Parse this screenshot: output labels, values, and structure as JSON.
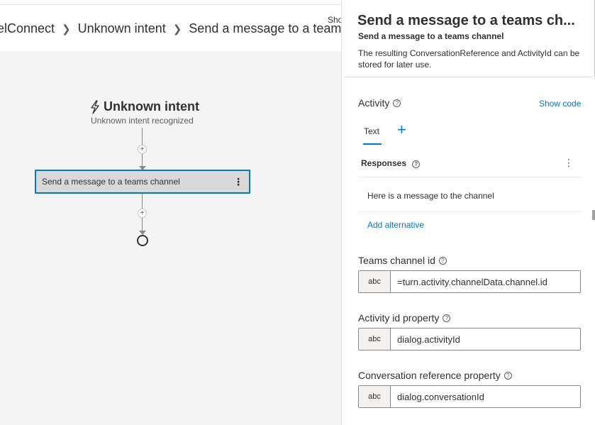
{
  "breadcrumb": {
    "items": [
      "elConnect",
      "Unknown intent",
      "Send a message to a teams channel"
    ],
    "cut_text": "Show code"
  },
  "canvas": {
    "trigger_title": "Unknown intent",
    "trigger_subtitle": "Unknown intent recognized",
    "node_label": "Send a message to a teams channel",
    "node_more": "⋮",
    "plus_glyph": "+"
  },
  "panel": {
    "title": "Send a message to a teams ch...",
    "subtitle": "Send a message to a teams channel",
    "description": "The resulting ConversationReference and ActivityId can be stored for later use.",
    "activity_label": "Activity",
    "show_code": "Show code",
    "tab_text": "Text",
    "tab_add": "+",
    "responses_label": "Responses",
    "responses_more": "⋮",
    "response_value": "Here is a message to the channel",
    "add_alternative": "Add alternative",
    "info_glyph": "?",
    "fields": [
      {
        "label": "Teams channel id",
        "type": "abc",
        "value": "=turn.activity.channelData.channel.id"
      },
      {
        "label": "Activity id property",
        "type": "abc",
        "value": "dialog.activityId"
      },
      {
        "label": "Conversation reference property",
        "type": "abc",
        "value": "dialog.conversationId"
      }
    ]
  },
  "colors": {
    "accent": "#0078d4",
    "canvas": "#f4f4f4",
    "node": "#d9d9d9"
  }
}
